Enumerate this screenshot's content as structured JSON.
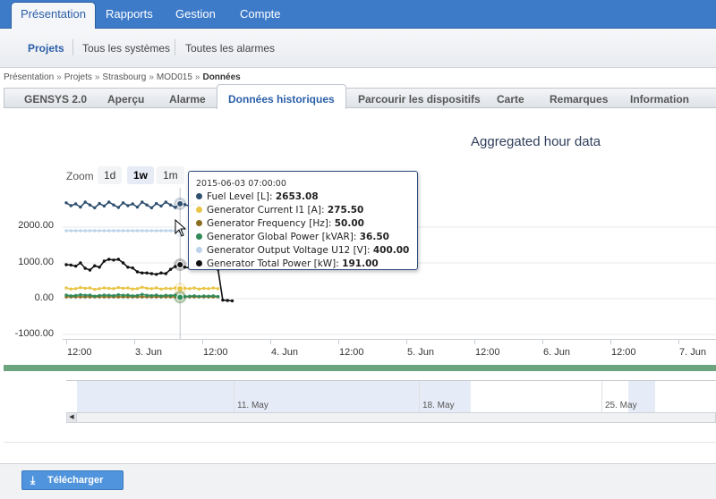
{
  "topnav": {
    "tabs": [
      {
        "label": "Présentation",
        "active": true
      },
      {
        "label": "Rapports",
        "active": false
      },
      {
        "label": "Gestion",
        "active": false
      },
      {
        "label": "Compte",
        "active": false
      }
    ]
  },
  "subnav": {
    "items": [
      {
        "label": "Projets",
        "active": true
      },
      {
        "label": "Tous les systèmes",
        "active": false
      },
      {
        "label": "Toutes les alarmes",
        "active": false
      }
    ]
  },
  "breadcrumb": {
    "items": [
      "Présentation",
      "Projets",
      "Strasbourg",
      "MOD015"
    ],
    "current": "Données",
    "separator": "»"
  },
  "page_tabs": [
    {
      "label": "GENSYS 2.0",
      "active": false
    },
    {
      "label": "Aperçu",
      "active": false
    },
    {
      "label": "Alarme",
      "active": false
    },
    {
      "label": "Données historiques",
      "active": true
    },
    {
      "label": "Parcourir les dispositifs",
      "active": false
    },
    {
      "label": "Carte",
      "active": false
    },
    {
      "label": "Remarques",
      "active": false
    },
    {
      "label": "Information",
      "active": false
    }
  ],
  "zoom": {
    "label": "Zoom",
    "buttons": [
      {
        "label": "1d",
        "selected": false
      },
      {
        "label": "1w",
        "selected": true
      },
      {
        "label": "1m",
        "selected": false
      }
    ]
  },
  "chart_data": {
    "type": "line",
    "title": "Aggregated hour data",
    "ylim": [
      -1000,
      3000
    ],
    "y_ticks": [
      "2000.00",
      "1000.00",
      "0.00",
      "-1000.00"
    ],
    "x_ticks": [
      "12:00",
      "3. Jun",
      "12:00",
      "4. Jun",
      "12:00",
      "5. Jun",
      "12:00",
      "6. Jun",
      "12:00",
      "7. Jun"
    ],
    "x_hours": [
      12,
      24,
      36,
      48,
      60,
      72,
      84,
      96,
      108,
      120
    ],
    "x_start": "2015-06-02 07:00",
    "grid": true,
    "series": [
      {
        "name": "Fuel Level [L]",
        "color": "#2f4f6f",
        "values": [
          2680,
          2600,
          2650,
          2560,
          2700,
          2620,
          2540,
          2660,
          2590,
          2700,
          2620,
          2550,
          2680,
          2600,
          2650,
          2560,
          2700,
          2620,
          2540,
          2660,
          2590,
          2700,
          2620,
          2550,
          2653,
          2630,
          2590,
          2640,
          2600,
          2660,
          2580,
          2620,
          2560
        ]
      },
      {
        "name": "Generator Current I1 [A]",
        "color": "#e8c547",
        "values": [
          300,
          270,
          280,
          310,
          290,
          300,
          260,
          280,
          300,
          290,
          280,
          310,
          290,
          300,
          270,
          280,
          320,
          290,
          280,
          300,
          270,
          290,
          280,
          300,
          275,
          290,
          280,
          300,
          270,
          290,
          280,
          300,
          280
        ]
      },
      {
        "name": "Generator Frequency [Hz]",
        "color": "#8a6d1e",
        "values": [
          50,
          50,
          50,
          50,
          50,
          50,
          50,
          50,
          50,
          50,
          50,
          50,
          50,
          50,
          50,
          50,
          50,
          50,
          50,
          50,
          50,
          50,
          50,
          50,
          50,
          50,
          50,
          50,
          50,
          50,
          50,
          50,
          50
        ]
      },
      {
        "name": "Generator Global Power [kVAR]",
        "color": "#2f8a5a",
        "values": [
          100,
          80,
          90,
          110,
          95,
          100,
          70,
          90,
          100,
          95,
          85,
          110,
          95,
          100,
          80,
          90,
          120,
          95,
          85,
          100,
          75,
          95,
          85,
          100,
          36,
          60,
          70,
          80,
          65,
          75,
          70,
          80,
          60
        ]
      },
      {
        "name": "Generator Output Voltage U12 [V]",
        "color": "#bcd3ea",
        "values": [
          1900,
          1900,
          1900,
          1900,
          1900,
          1900,
          1900,
          1900,
          1900,
          1900,
          1900,
          1900,
          1900,
          1900,
          1900,
          1900,
          1900,
          1900,
          1900,
          1900,
          1900,
          1900,
          1900,
          1900,
          1900
        ]
      },
      {
        "name": "Generator Total Power [kW]",
        "color": "#111111",
        "values": [
          950,
          940,
          910,
          1000,
          850,
          800,
          920,
          880,
          1050,
          1100,
          1080,
          1100,
          1000,
          880,
          860,
          750,
          720,
          720,
          700,
          680,
          720,
          700,
          820,
          900,
          950,
          880,
          860,
          900,
          950,
          900,
          850,
          880,
          820,
          -40,
          -50,
          -60
        ]
      }
    ],
    "hover_index": 24,
    "hover_time": "2015-06-03 07:00:00",
    "hover_values": [
      "2653.08",
      "275.50",
      "50.00",
      "36.50",
      "400.00",
      "191.00"
    ]
  },
  "navigator": {
    "labels": [
      "11. May",
      "18. May",
      "25. May"
    ],
    "scroll_left_icon": "triangle-left-icon"
  },
  "footer": {
    "download_label": "Télécharger",
    "download_icon": "download-icon"
  }
}
